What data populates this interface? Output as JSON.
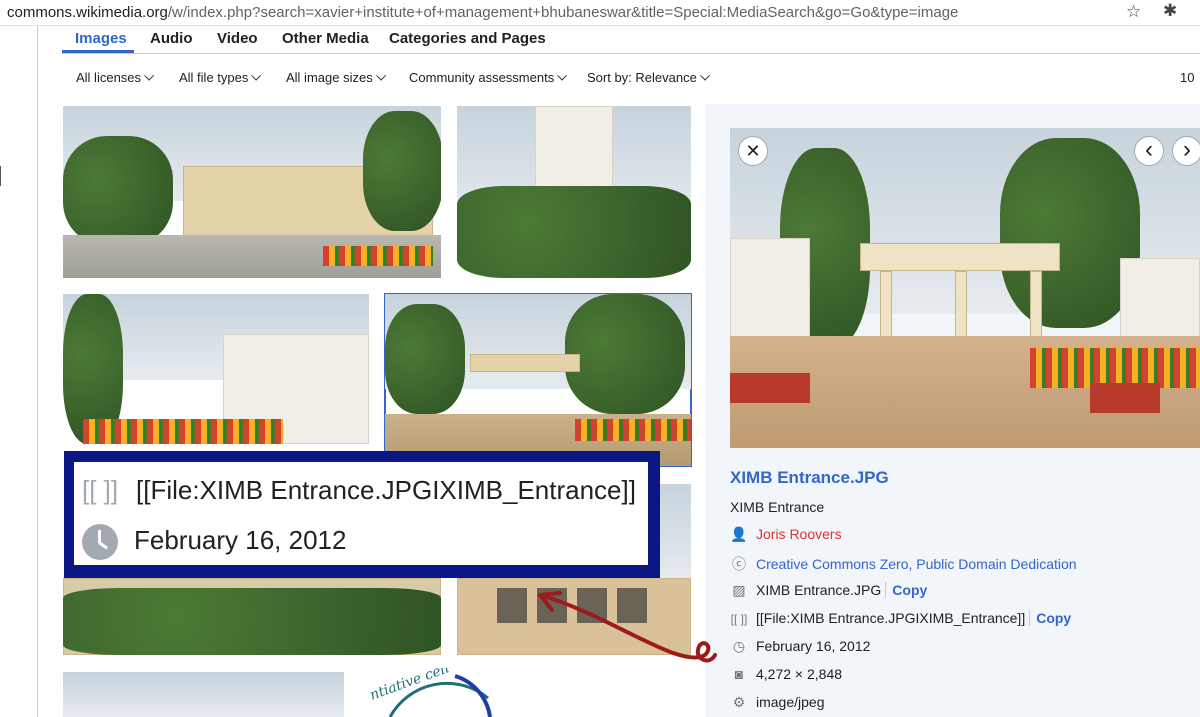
{
  "browser": {
    "url_domain": "commons.wikimedia.org",
    "url_path": "/w/index.php?search=xavier+institute+of+management+bhubaneswar&title=Special:MediaSearch&go=Go&type=image"
  },
  "tabs": [
    {
      "label": "Images",
      "active": true
    },
    {
      "label": "Audio"
    },
    {
      "label": "Video"
    },
    {
      "label": "Other Media"
    },
    {
      "label": "Categories and Pages"
    }
  ],
  "filters": [
    {
      "label": "All licenses"
    },
    {
      "label": "All file types"
    },
    {
      "label": "All image sizes"
    },
    {
      "label": "Community assessments"
    },
    {
      "label": "Sort by: Relevance"
    }
  ],
  "result_count_partial": "10",
  "detail": {
    "title": "XIMB Entrance.JPG",
    "caption": "XIMB Entrance",
    "author": "Joris Roovers",
    "license": "Creative Commons Zero, Public Domain Dedication",
    "filename": "XIMB Entrance.JPG",
    "wikitext": "[[File:XIMB Entrance.JPGIXIMB_Entrance]]",
    "date": "February 16, 2012",
    "dimensions": "4,272 × 2,848",
    "mime": "image/jpeg",
    "copy_label": "Copy",
    "close_glyph": "✕",
    "prev_glyph": "‹",
    "next_glyph": "›"
  },
  "callout": {
    "wikitext": "[[File:XIMB Entrance.JPGIXIMB_Entrance]]",
    "date": "February 16, 2012",
    "wikitext_icon": "[[ ]]"
  },
  "thumb_logo_text": "ntiative cell",
  "icons": {
    "author": "person-icon",
    "license": "cc-icon",
    "filename": "image-icon",
    "wikitext": "brackets-icon",
    "date": "clock-icon",
    "dimensions": "camera-icon",
    "mime": "gear-icon"
  },
  "colors": {
    "accent": "#3366cc",
    "callout_border": "#0b1783",
    "arrow": "#9c1b1b",
    "author_link": "#d33"
  }
}
